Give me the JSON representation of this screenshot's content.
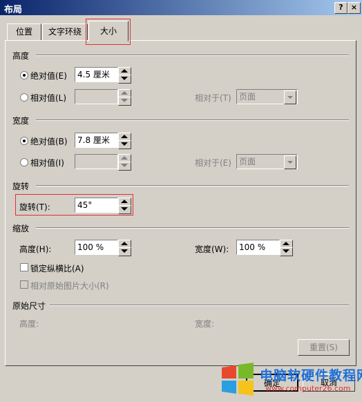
{
  "window": {
    "title": "布局",
    "help_label": "?",
    "close_label": "×"
  },
  "tabs": [
    {
      "label": "位置"
    },
    {
      "label": "文字环绕"
    },
    {
      "label": "大小"
    }
  ],
  "height_group": {
    "title": "高度",
    "absolute_label": "绝对值(E)",
    "absolute_value": "4.5 厘米",
    "relative_label": "相对值(L)",
    "relative_value": "",
    "relative_to_label": "相对于(T)",
    "relative_to_value": "页面"
  },
  "width_group": {
    "title": "宽度",
    "absolute_label": "绝对值(B)",
    "absolute_value": "7.8 厘米",
    "relative_label": "相对值(I)",
    "relative_value": "",
    "relative_to_label": "相对于(E)",
    "relative_to_value": "页面"
  },
  "rotate_group": {
    "title": "旋转",
    "rotate_label": "旋转(T):",
    "rotate_value": "45°"
  },
  "scale_group": {
    "title": "缩放",
    "height_label": "高度(H):",
    "height_value": "100 %",
    "width_label": "宽度(W):",
    "width_value": "100 %",
    "lock_aspect_label": "锁定纵横比(A)",
    "relative_original_label": "相对原始图片大小(R)"
  },
  "original_group": {
    "title": "原始尺寸",
    "height_label": "高度:",
    "width_label": "宽度:",
    "reset_label": "重置(S)"
  },
  "footer": {
    "ok_label": "确定",
    "cancel_label": "取消"
  },
  "watermark": {
    "text": "电脑软硬件教程网",
    "url": "www.computer26.com"
  },
  "colors": {
    "highlight": "#e03030",
    "titlebar": "#0a246a"
  }
}
